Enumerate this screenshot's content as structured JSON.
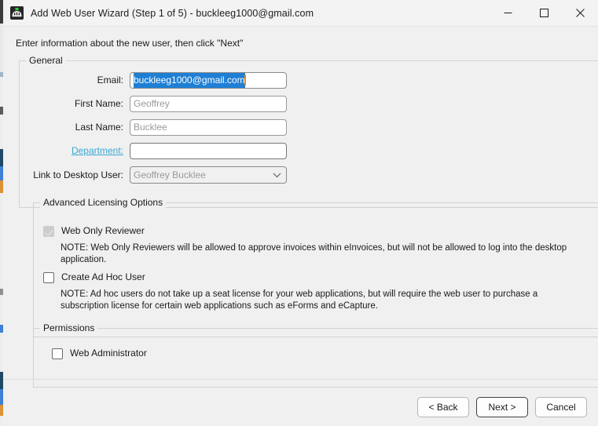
{
  "window": {
    "title": "Add Web User Wizard (Step 1 of 5) - buckleeg1000@gmail.com",
    "app_icon": "wizard-app-icon",
    "controls": {
      "minimize": "—",
      "maximize": "☐",
      "close": "✕"
    }
  },
  "instruction": "Enter information about the new user, then click \"Next\"",
  "general": {
    "legend": "General",
    "fields": {
      "email": {
        "label": "Email:",
        "value": "buckleeg1000@gmail.com",
        "selected": true
      },
      "first_name": {
        "label": "First Name:",
        "value": "Geoffrey",
        "ghost": true
      },
      "last_name": {
        "label": "Last Name:",
        "value": "Bucklee",
        "ghost": true
      },
      "department": {
        "label": "Department:",
        "value": "",
        "is_link": true
      },
      "link_desktop_user": {
        "label": "Link to Desktop User:",
        "value": "Geoffrey  Bucklee",
        "chevron": "⌄"
      }
    }
  },
  "licensing": {
    "legend": "Advanced Licensing Options",
    "web_only_reviewer": {
      "label": "Web Only Reviewer",
      "checked": true,
      "disabled": true,
      "note": "NOTE: Web Only Reviewers will be allowed to approve invoices within eInvoices, but will not be allowed to log into the desktop application."
    },
    "create_ad_hoc_user": {
      "label": "Create Ad Hoc User",
      "checked": false,
      "note": "NOTE: Ad hoc users do not take up a seat license for your web applications, but will require the web user to purchase a subscription license for certain web applications such as eForms and eCapture."
    }
  },
  "permissions": {
    "legend": "Permissions",
    "web_administrator": {
      "label": "Web Administrator",
      "checked": false
    }
  },
  "buttons": {
    "back": "< Back",
    "next": "Next >",
    "cancel": "Cancel"
  },
  "colors": {
    "selection_blue": "#1e7fd4",
    "caret_orange": "#e88b1e",
    "link_blue": "#3aa7d4",
    "window_bg": "#f0f0f0",
    "titlebar_bg": "#f3f3f3"
  }
}
